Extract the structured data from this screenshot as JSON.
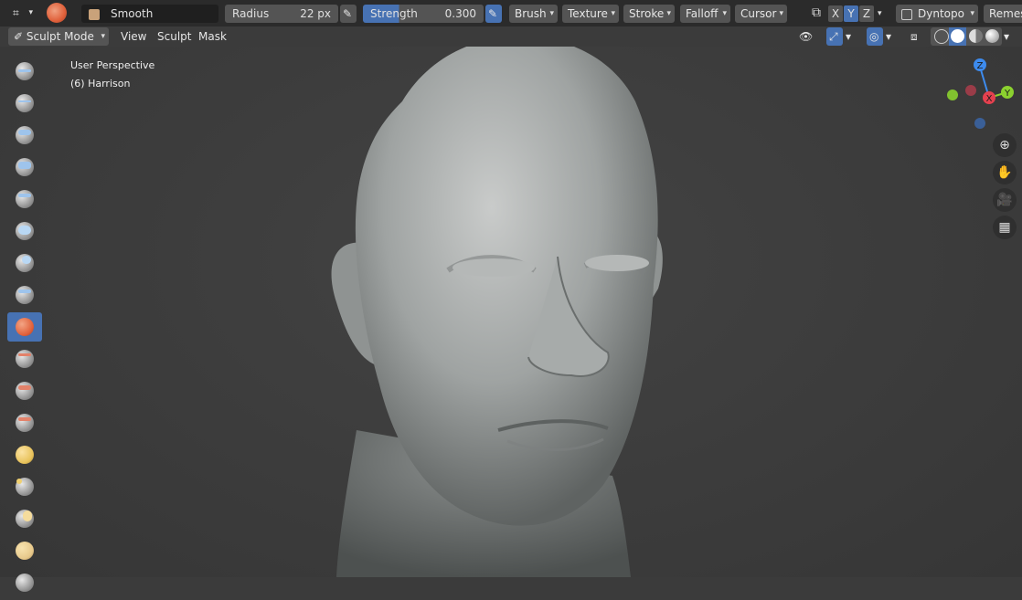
{
  "toolbar": {
    "brush_name": "Smooth",
    "radius_label": "Radius",
    "radius_value": "22 px",
    "strength_label": "Strength",
    "strength_value": "0.300",
    "menus": [
      "Brush",
      "Texture",
      "Stroke",
      "Falloff",
      "Cursor"
    ],
    "axes": [
      "X",
      "Y",
      "Z"
    ],
    "dyntopo_label": "Dyntopo",
    "remesh_label": "Remesh"
  },
  "header": {
    "mode_label": "Sculpt Mode",
    "menus": [
      "View",
      "Sculpt",
      "Mask"
    ]
  },
  "viewport": {
    "perspective_label": "User Perspective",
    "object_label": "(6) Harrison",
    "gizmo": {
      "z": "Z",
      "y": "Y",
      "x": "X"
    }
  },
  "colors": {
    "accent": "#4772b3",
    "background": "#3b3b3b",
    "gizmo_x": "#e5414f",
    "gizmo_y": "#8bd12f",
    "gizmo_z": "#3d8bee"
  },
  "tools": [
    "draw",
    "draw-sharp",
    "clay",
    "clay-strips",
    "clay-thumb",
    "layer",
    "inflate",
    "blob",
    "smooth",
    "flatten",
    "fill",
    "scrape",
    "multiplane-scrape",
    "pinch",
    "grab",
    "elastic-deform",
    "snake-hook"
  ]
}
